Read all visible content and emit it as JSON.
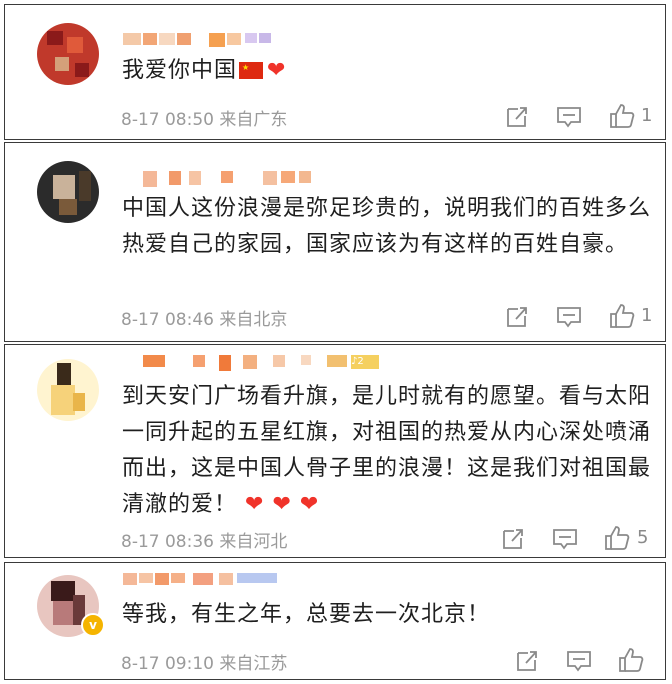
{
  "comments": [
    {
      "text": "我爱你中国",
      "flag": "🇨🇳",
      "hearts": "❤",
      "date": "8-17 08:50",
      "location": "来自广东",
      "like_count": "1",
      "avatar_colors": [
        "#c0392b",
        "#e05a3a",
        "#8b1a1a",
        "#d4a07a"
      ]
    },
    {
      "text": "中国人这份浪漫是弥足珍贵的，说明我们的百姓多么热爱自己的家园，国家应该为有这样的百姓自豪。",
      "date": "8-17 08:46",
      "location": "来自北京",
      "like_count": "1",
      "avatar_colors": [
        "#2b2b2b",
        "#7a5a3a",
        "#c9b29a",
        "#4a3a2a"
      ]
    },
    {
      "text": "到天安门广场看升旗，是儿时就有的愿望。看与太阳一同升起的五星红旗，对祖国的热爱从内心深处喷涌而出，这是中国人骨子里的浪漫！这是我们对祖国最清澈的爱！",
      "hearts": "❤ ❤ ❤",
      "date": "8-17 08:36",
      "location": "来自河北",
      "like_count": "5",
      "avatar_colors": [
        "#f6d27a",
        "#3a2a1a",
        "#e9b54a",
        "#fff4d0"
      ]
    },
    {
      "text": "等我，有生之年，总要去一次北京！",
      "date": "8-17 09:10",
      "location": "来自江苏",
      "like_count": "",
      "avatar_colors": [
        "#3a1a1a",
        "#b87a7a",
        "#e8c6c0",
        "#6a3a3a"
      ],
      "verified_badge": "v"
    }
  ],
  "icons": {
    "share": "share-icon",
    "comment": "comment-icon",
    "like": "like-icon"
  },
  "colors": {
    "heart": "#f0332a",
    "meta": "#9a9a9a",
    "text": "#1f1f1f",
    "badge": "#f5b400"
  }
}
